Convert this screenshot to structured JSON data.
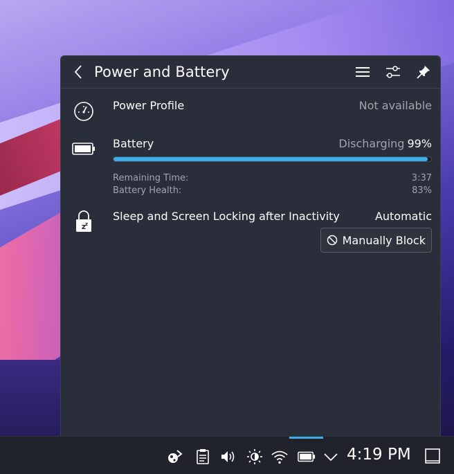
{
  "panel": {
    "title": "Power and Battery"
  },
  "power_profile": {
    "label": "Power Profile",
    "value": "Not available"
  },
  "battery": {
    "label": "Battery",
    "state": "Discharging",
    "percent_text": "99%",
    "percent": 99,
    "remaining_label": "Remaining Time:",
    "remaining_value": "3:37",
    "health_label": "Battery Health:",
    "health_value": "83%"
  },
  "sleep": {
    "label": "Sleep and Screen Locking after Inactivity",
    "value": "Automatic",
    "block_button": "Manually Block"
  },
  "taskbar": {
    "clock": "4:19 PM",
    "tray_icons": [
      "network-share-icon",
      "clipboard-icon",
      "volume-icon",
      "brightness-icon",
      "wifi-icon",
      "battery-icon",
      "chevron-down-icon"
    ]
  },
  "colors": {
    "accent": "#3daee9",
    "panel_bg": "#2a2e3a",
    "muted_text": "#a1a4ab"
  }
}
